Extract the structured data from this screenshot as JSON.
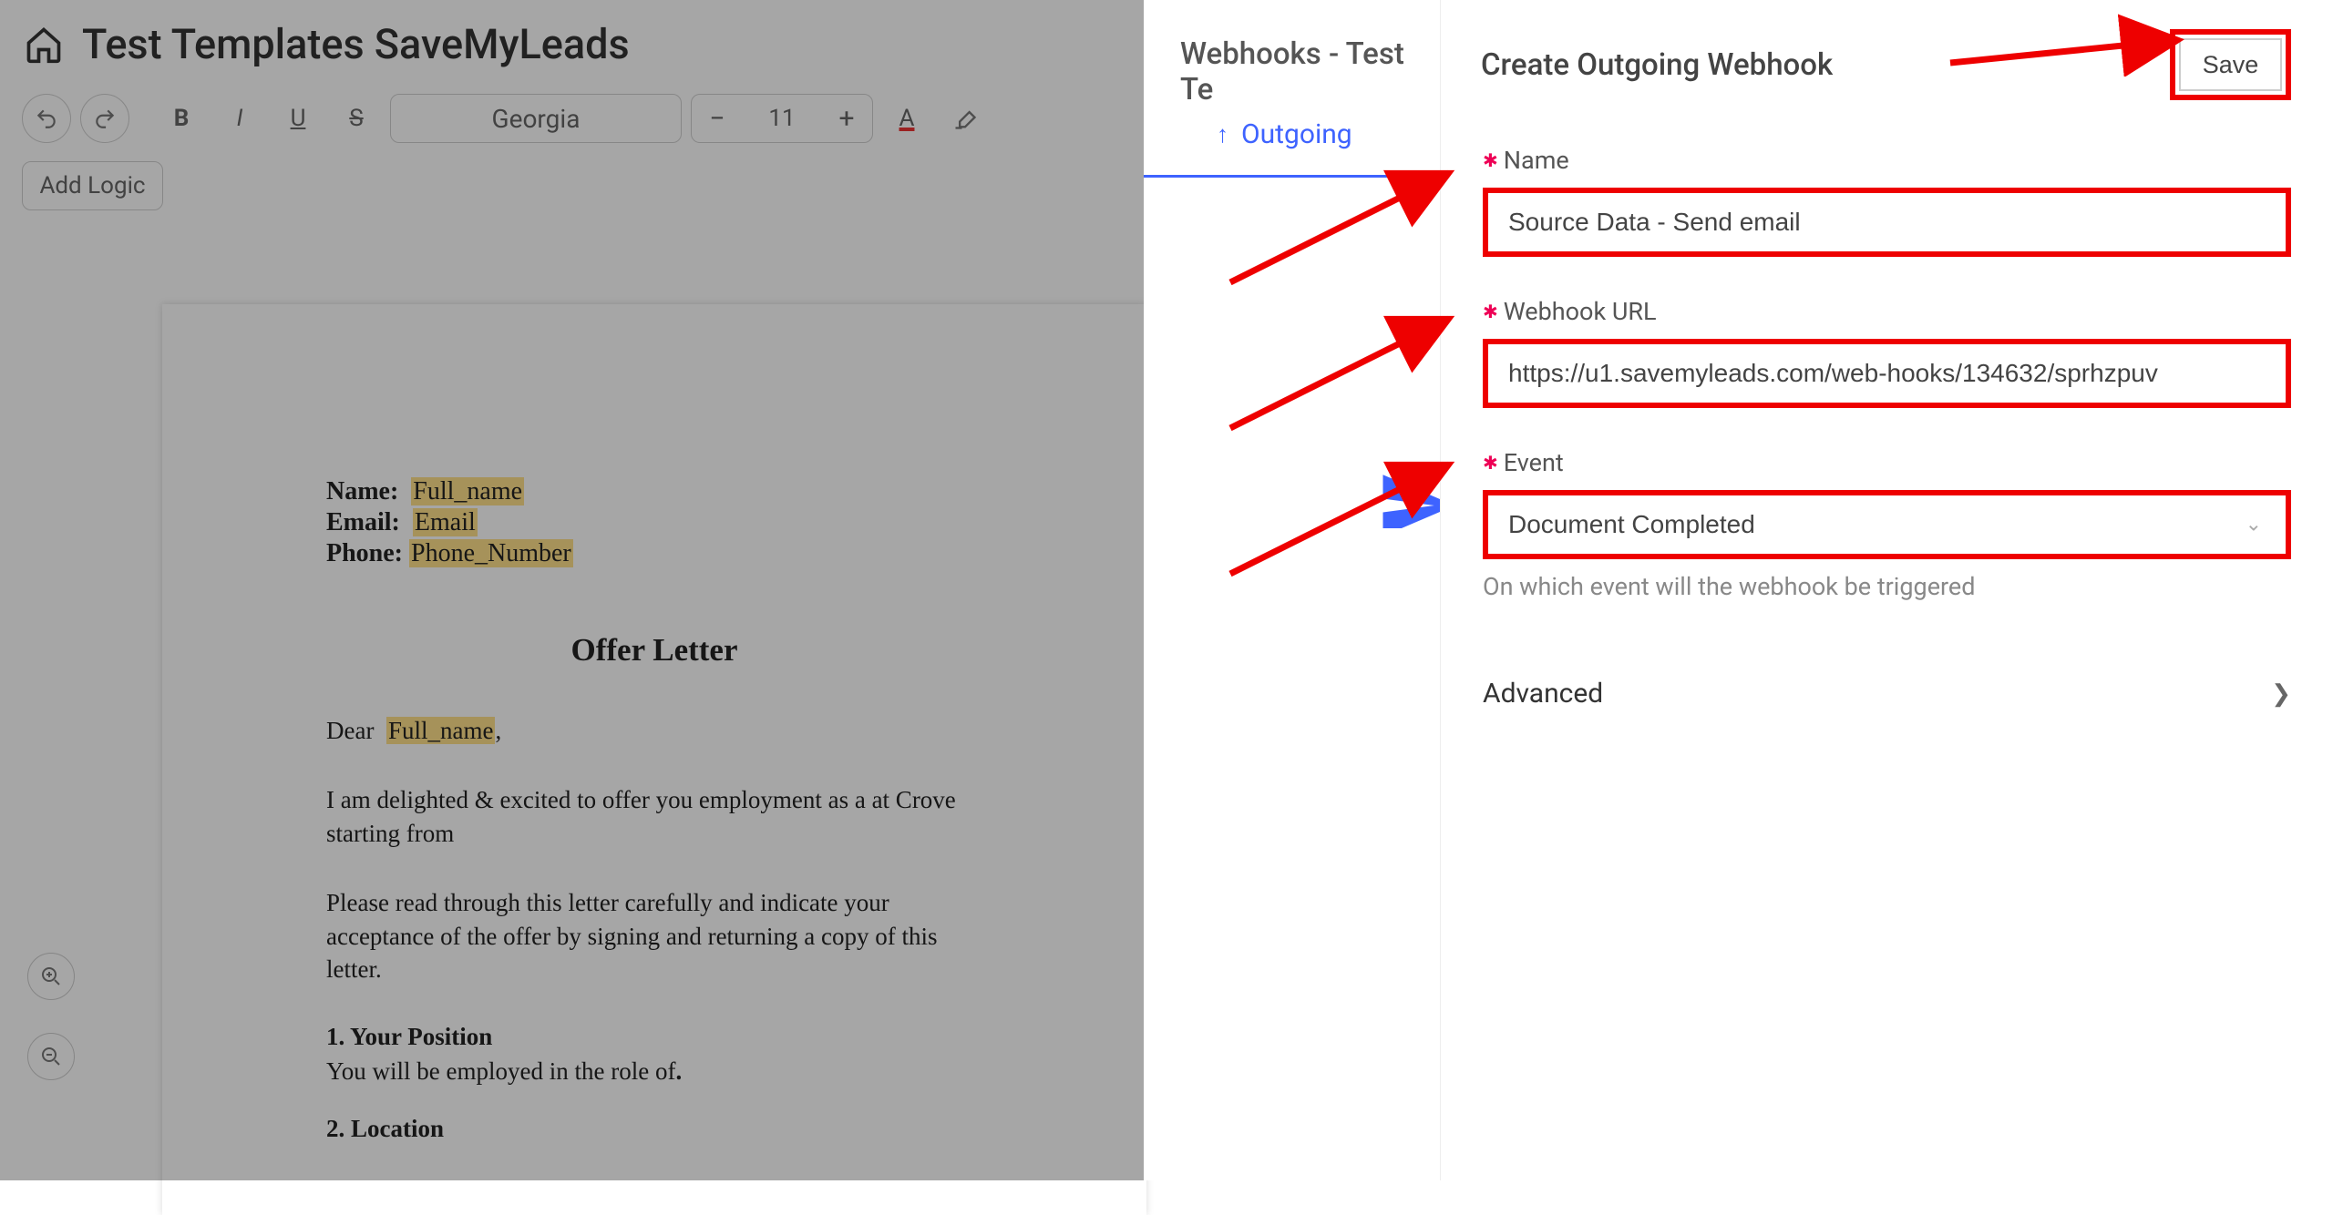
{
  "header": {
    "title": "Test Templates SaveMyLeads"
  },
  "toolbar": {
    "font_family": "Georgia",
    "font_size": "11",
    "add_logic": "Add Logic"
  },
  "document": {
    "fields": {
      "name_label": "Name:",
      "name_value": "Full_name",
      "email_label": "Email:",
      "email_value": "Email",
      "phone_label": "Phone:",
      "phone_value": "Phone_Number"
    },
    "title": "Offer Letter",
    "greeting_pre": "Dear ",
    "greeting_var": "Full_name",
    "greeting_post": ",",
    "para1": "I am delighted & excited to offer you employment as a at Crove starting from",
    "para2": "Please read through this letter carefully and indicate your acceptance of the offer by signing and returning a copy of this letter.",
    "sect1_title": "1. Your Position",
    "sect1_body_pre": "You will be employed in the role of",
    "sect1_body_post": ".",
    "sect2_title": "2. Location"
  },
  "midcolumn": {
    "title": "Webhooks - Test Te",
    "tab_outgoing": "Outgoing"
  },
  "form": {
    "panel_title": "Create Outgoing Webhook",
    "save_label": "Save",
    "name_label": "Name",
    "name_value": "Source Data - Send email",
    "url_label": "Webhook URL",
    "url_value": "https://u1.savemyleads.com/web-hooks/134632/sprhzpuv",
    "event_label": "Event",
    "event_value": "Document Completed",
    "event_hint": "On which event will the webhook be triggered",
    "advanced_label": "Advanced"
  }
}
